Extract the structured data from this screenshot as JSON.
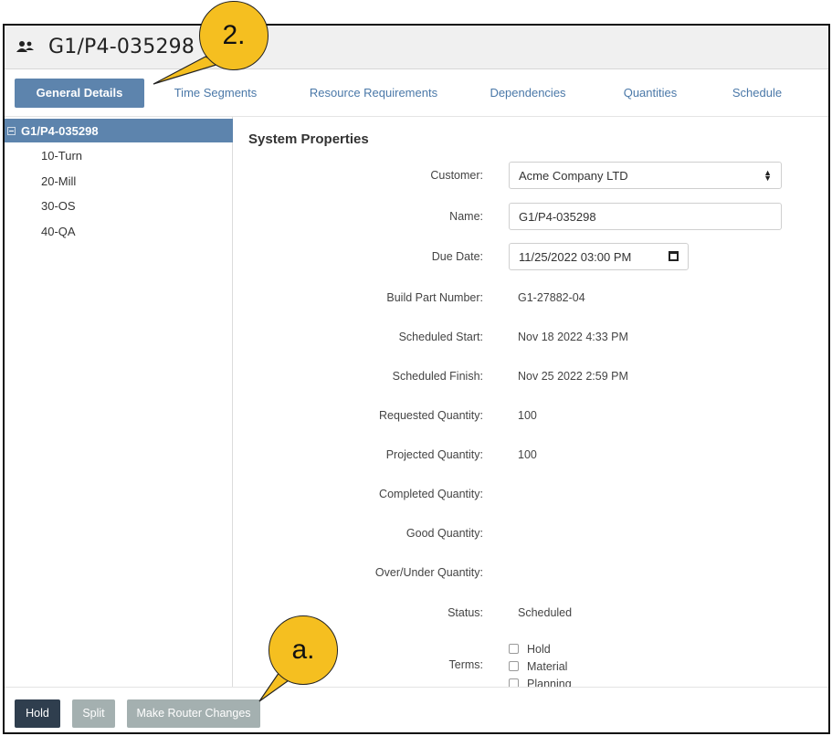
{
  "header": {
    "title": "G1/P4-035298",
    "icon": "people-settings-icon"
  },
  "tabs": [
    {
      "label": "General Details",
      "active": true
    },
    {
      "label": "Time Segments"
    },
    {
      "label": "Resource Requirements"
    },
    {
      "label": "Dependencies"
    },
    {
      "label": "Quantities"
    },
    {
      "label": "Schedule"
    }
  ],
  "tree": {
    "root": "G1/P4-035298",
    "items": [
      "10-Turn",
      "20-Mill",
      "30-OS",
      "40-QA"
    ]
  },
  "properties": {
    "section_title": "System Properties",
    "customer": {
      "label": "Customer:",
      "value": "Acme Company LTD"
    },
    "name": {
      "label": "Name:",
      "value": "G1/P4-035298"
    },
    "due_date": {
      "label": "Due Date:",
      "value": "11/25/2022 03:00 PM"
    },
    "build_part_number": {
      "label": "Build Part Number:",
      "value": "G1-27882-04"
    },
    "scheduled_start": {
      "label": "Scheduled Start:",
      "value": "Nov 18 2022 4:33 PM"
    },
    "scheduled_finish": {
      "label": "Scheduled Finish:",
      "value": "Nov 25 2022 2:59 PM"
    },
    "requested_quantity": {
      "label": "Requested Quantity:",
      "value": "100"
    },
    "projected_quantity": {
      "label": "Projected Quantity:",
      "value": "100"
    },
    "completed_quantity": {
      "label": "Completed Quantity:",
      "value": ""
    },
    "good_quantity": {
      "label": "Good Quantity:",
      "value": ""
    },
    "over_under_quantity": {
      "label": "Over/Under Quantity:",
      "value": ""
    },
    "status": {
      "label": "Status:",
      "value": "Scheduled"
    },
    "terms": {
      "label": "Terms:",
      "options": [
        "Hold",
        "Material",
        "Planning"
      ]
    }
  },
  "footer": {
    "hold_label": "Hold",
    "split_label": "Split",
    "router_label": "Make Router Changes"
  },
  "callouts": {
    "step": "2.",
    "sub": "a."
  },
  "colors": {
    "accent": "#5d84ad",
    "link": "#4a78a8",
    "dark_button": "#2f3e4e",
    "disabled_button": "#a4b0b0",
    "callout": "#f5bf20"
  }
}
